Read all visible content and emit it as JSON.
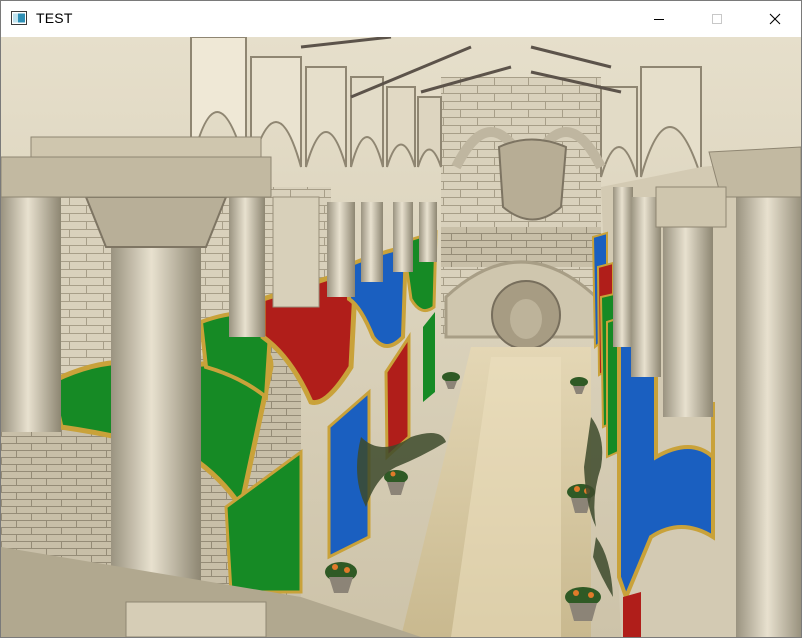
{
  "window": {
    "title": "TEST",
    "app_icon": "window-app-icon",
    "controls": {
      "minimize_icon": "minimize-icon",
      "maximize_icon": "maximize-icon",
      "close_icon": "close-icon"
    }
  },
  "scene": {
    "colors": {
      "stone_light": "#e3dcc8",
      "stone_mid": "#c9bfa6",
      "stone_dark": "#8f8672",
      "floor": "#d8cbaa",
      "banner_green": "#168a25",
      "banner_red": "#b01e1a",
      "banner_blue": "#1a5fc0",
      "banner_trim": "#c9a23a",
      "plant": "#2f5a25",
      "flower": "#e07a2a"
    }
  }
}
